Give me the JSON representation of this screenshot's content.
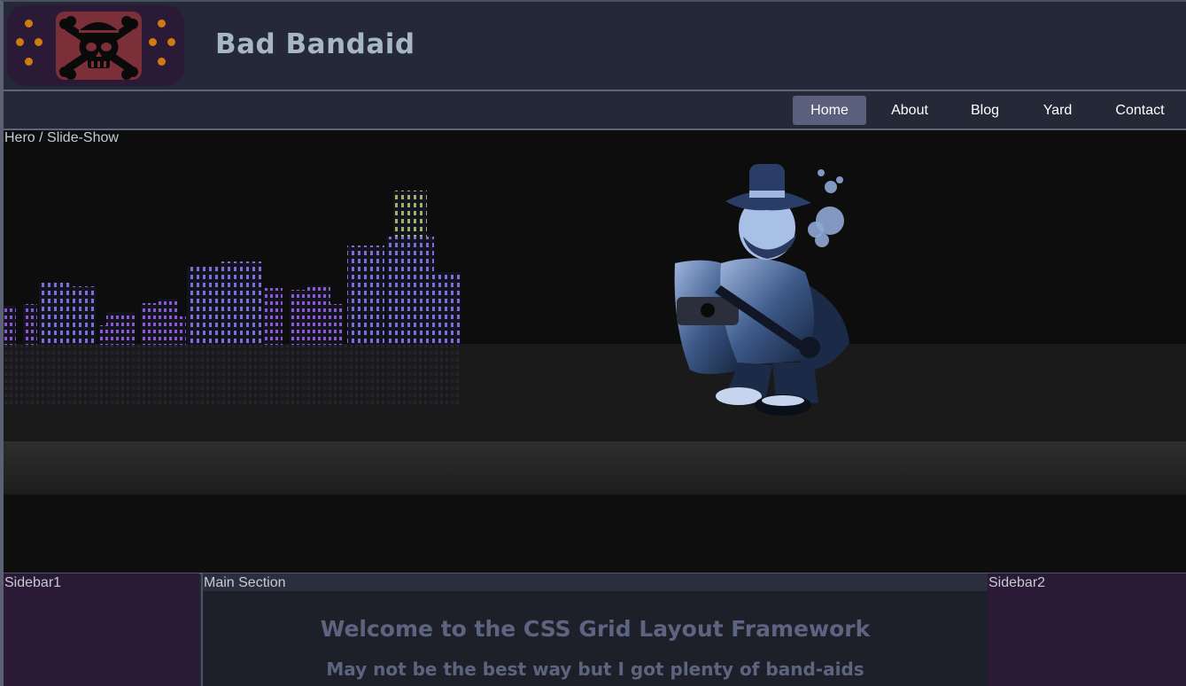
{
  "header": {
    "logo": "skull-crossbones-bandaid-logo",
    "site_title": "Bad Bandaid"
  },
  "nav": {
    "items": [
      {
        "label": "Home",
        "active": true
      },
      {
        "label": "About",
        "active": false
      },
      {
        "label": "Blog",
        "active": false
      },
      {
        "label": "Yard",
        "active": false
      },
      {
        "label": "Contact",
        "active": false
      }
    ]
  },
  "hero": {
    "label": "Hero / Slide-Show",
    "image": "city-skyline-and-gangster-mascot"
  },
  "sidebar1": {
    "label": "Sidebar1"
  },
  "main": {
    "label": "Main Section",
    "heading": "Welcome to the CSS Grid Layout Framework",
    "subheading": "May not be the best way but I got plenty of band-aids"
  },
  "sidebar2": {
    "label": "Sidebar2"
  },
  "colors": {
    "page_bg": "#252937",
    "sidebar_bg": "#2b1a35",
    "nav_active_bg": "#5a607b",
    "title_color": "#a6b6c2",
    "heading_color": "#5d6480",
    "logo_dot": "#d27a12"
  }
}
